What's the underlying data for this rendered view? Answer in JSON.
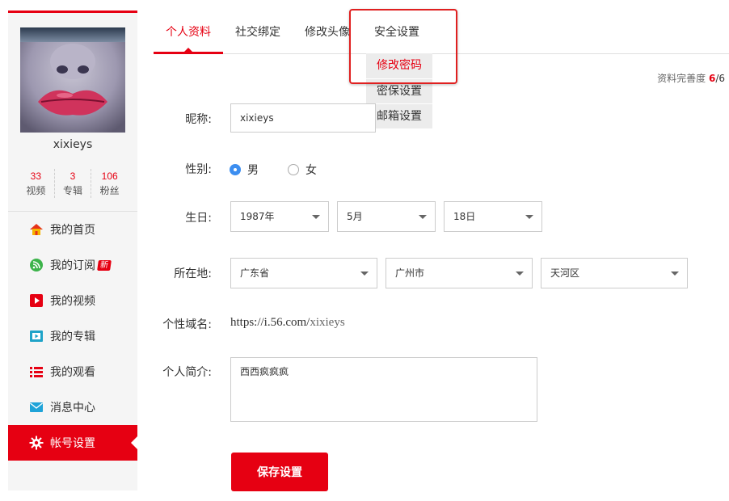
{
  "sidebar": {
    "username": "xixieys",
    "stats": [
      {
        "num": "33",
        "label": "视频"
      },
      {
        "num": "3",
        "label": "专辑"
      },
      {
        "num": "106",
        "label": "粉丝"
      }
    ],
    "nav": [
      {
        "label": "我的首页",
        "icon": "home-icon"
      },
      {
        "label": "我的订阅",
        "icon": "subscribe-icon",
        "badge": "新"
      },
      {
        "label": "我的视频",
        "icon": "video-icon"
      },
      {
        "label": "我的专辑",
        "icon": "album-icon"
      },
      {
        "label": "我的观看",
        "icon": "watch-list-icon"
      },
      {
        "label": "消息中心",
        "icon": "mail-icon"
      },
      {
        "label": "帐号设置",
        "icon": "settings-gear-icon",
        "active": true
      }
    ]
  },
  "tabs": [
    {
      "label": "个人资料",
      "active": true
    },
    {
      "label": "社交绑定"
    },
    {
      "label": "修改头像"
    },
    {
      "label": "安全设置"
    }
  ],
  "security_menu": [
    {
      "label": "修改密码",
      "active": true
    },
    {
      "label": "密保设置"
    },
    {
      "label": "邮箱设置"
    }
  ],
  "completeness": {
    "label": "资料完善度",
    "value": "6",
    "total": "/6"
  },
  "form": {
    "nickname": {
      "label": "昵称:",
      "value": "xixieys"
    },
    "gender": {
      "label": "性别:",
      "options": [
        "男",
        "女"
      ],
      "selected": "男"
    },
    "birthday": {
      "label": "生日:",
      "year": "1987年",
      "month": "5月",
      "day": "18日"
    },
    "location": {
      "label": "所在地:",
      "province": "广东省",
      "city": "广州市",
      "district": "天河区"
    },
    "domain": {
      "label": "个性域名:",
      "prefix": "https://i.56.com/",
      "user": "xixieys"
    },
    "bio": {
      "label": "个人简介:",
      "value": "西西疯疯疯"
    }
  },
  "save_label": "保存设置",
  "colors": {
    "accent": "#e60012",
    "radio": "#3c8ef0"
  }
}
